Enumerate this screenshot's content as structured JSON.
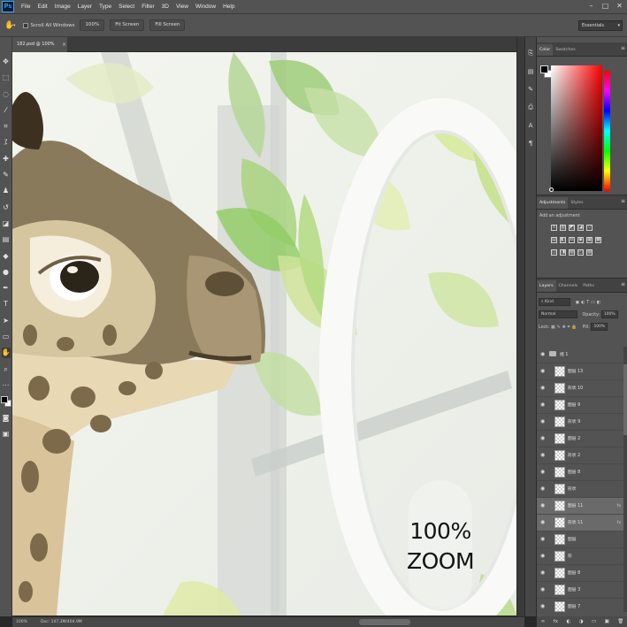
{
  "menubar": {
    "logo": "Ps",
    "items": [
      "File",
      "Edit",
      "Image",
      "Layer",
      "Type",
      "Select",
      "Filter",
      "3D",
      "View",
      "Window",
      "Help"
    ],
    "window_controls": [
      "–",
      "□",
      "✕"
    ]
  },
  "options": {
    "scroll_all_windows": "Scroll All Windows",
    "zoom_100": "100%",
    "fit_screen": "Fit Screen",
    "fill_screen": "Fill Screen",
    "workspace": "Essentials"
  },
  "document": {
    "tab_title": "182.psd @ 100% (RGB/8)",
    "close": "×"
  },
  "canvas": {
    "overlay_line1": "100%",
    "overlay_line2": "ZOOM"
  },
  "status": {
    "zoom": "100%",
    "doc_info": "Doc: 147.3M/404.9M"
  },
  "color_panel": {
    "tabs": [
      "Color",
      "Swatches"
    ],
    "foreground": "#000000",
    "background": "#ffffff"
  },
  "adjustments_panel": {
    "tabs": [
      "Adjustments",
      "Styles"
    ],
    "label": "Add an adjustment",
    "row1": [
      "☼",
      "▥",
      "◩",
      "◪",
      "▽"
    ],
    "row2": [
      "▤",
      "◧",
      "⚖",
      "◉",
      "▦",
      "▩"
    ],
    "row3": [
      "◫",
      "◨",
      "▧",
      "◰",
      "▨"
    ]
  },
  "layers_panel": {
    "tabs": [
      "Layers",
      "Channels",
      "Paths"
    ],
    "filter_kind": "Kind",
    "blend_mode": "Normal",
    "opacity_label": "Opacity:",
    "opacity_value": "100%",
    "lock_label": "Lock:",
    "fill_label": "Fill:",
    "fill_value": "100%",
    "layers": [
      {
        "name": "组 1",
        "type": "group",
        "fx": ""
      },
      {
        "name": "图层 13",
        "type": "layer",
        "fx": ""
      },
      {
        "name": "形状 10",
        "type": "layer",
        "fx": ""
      },
      {
        "name": "图层 9",
        "type": "layer",
        "fx": ""
      },
      {
        "name": "形状 9",
        "type": "layer",
        "fx": ""
      },
      {
        "name": "图层 2",
        "type": "layer",
        "fx": ""
      },
      {
        "name": "形状 2",
        "type": "layer",
        "fx": ""
      },
      {
        "name": "图层 8",
        "type": "layer",
        "fx": ""
      },
      {
        "name": "形状",
        "type": "layer",
        "fx": ""
      },
      {
        "name": "图层 11",
        "type": "layer",
        "fx": "fx"
      },
      {
        "name": "形状 11",
        "type": "layer",
        "fx": "fx"
      },
      {
        "name": "图层",
        "type": "layer",
        "fx": ""
      },
      {
        "name": "形",
        "type": "layer",
        "fx": ""
      },
      {
        "name": "图层 8",
        "type": "layer",
        "fx": ""
      },
      {
        "name": "图层 3",
        "type": "layer",
        "fx": ""
      },
      {
        "name": "图层 7",
        "type": "layer",
        "fx": ""
      }
    ],
    "footer_icons": [
      "∞",
      "fx",
      "◐",
      "◑",
      "▭",
      "▣",
      "🗑"
    ]
  }
}
